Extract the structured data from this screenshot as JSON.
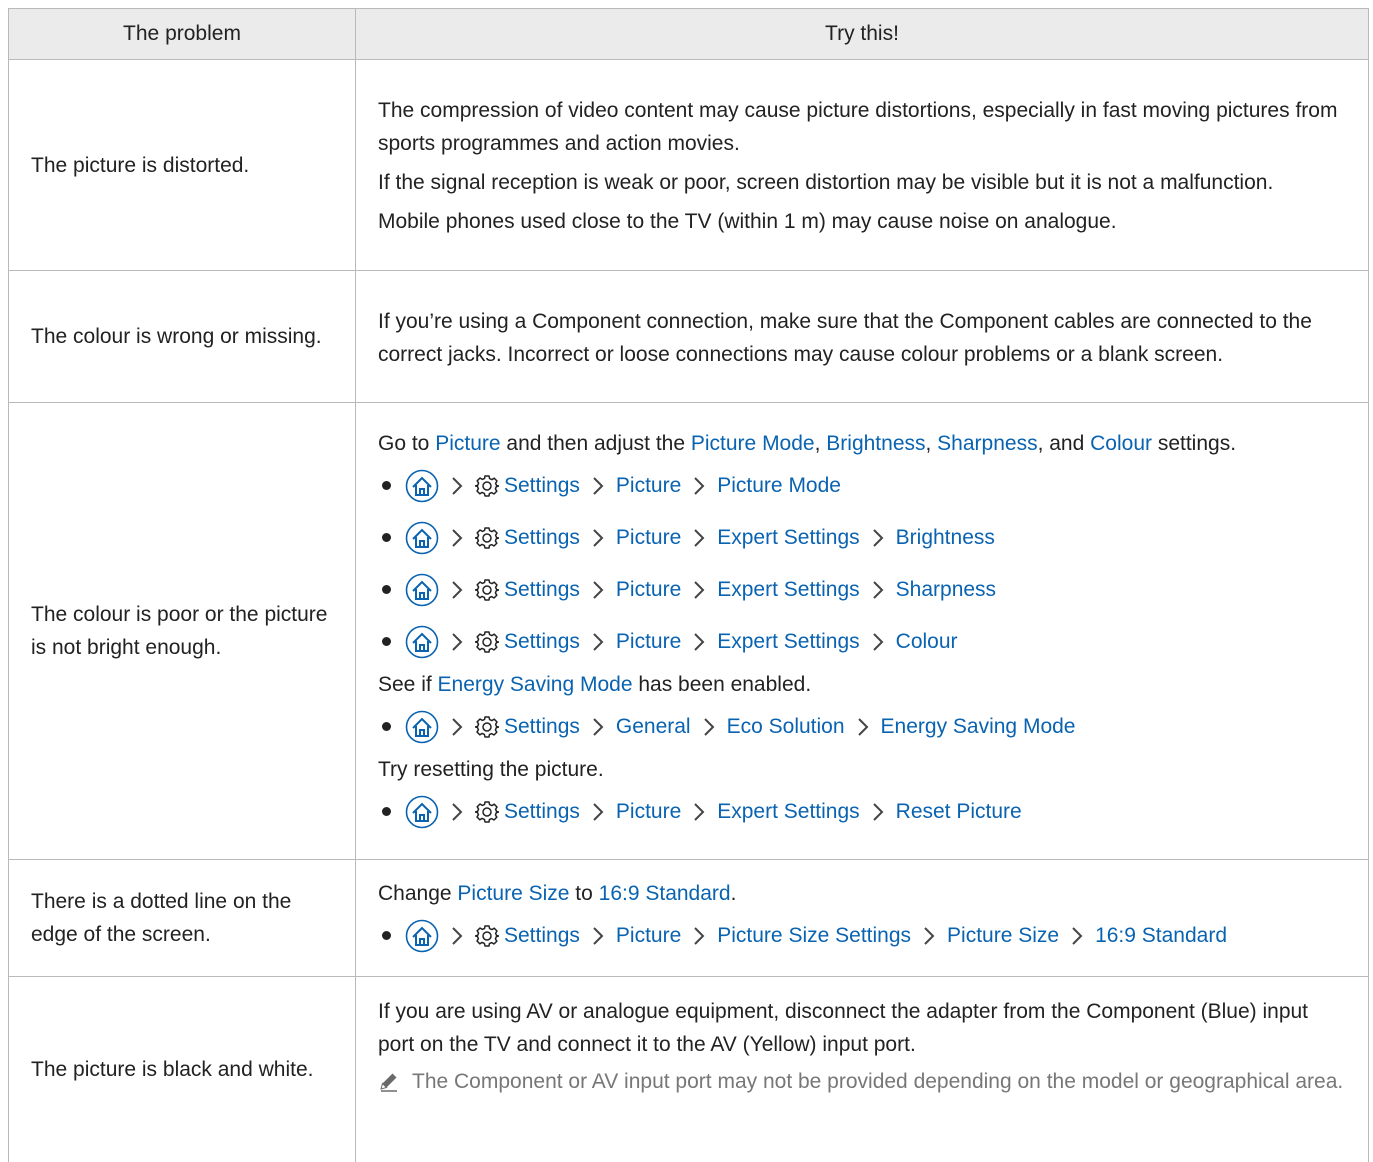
{
  "header": {
    "col1": "The problem",
    "col2": "Try this!"
  },
  "rows": [
    {
      "problem": "The picture is distorted.",
      "p1": "The compression of video content may cause picture distortions, especially in fast moving pictures from sports programmes and action movies.",
      "p2": "If the signal reception is weak or poor, screen distortion may be visible but it is not a malfunction.",
      "p3": "Mobile phones used close to the TV (within 1 m) may cause noise on analogue."
    },
    {
      "problem": "The colour is wrong or missing.",
      "p1": "If you’re using a Component connection, make sure that the Component cables are connected to the correct jacks. Incorrect or loose connections may cause colour problems or a blank screen."
    },
    {
      "problem": "The colour is poor or the picture is not bright enough.",
      "intro": {
        "a": "Go to ",
        "picture": "Picture",
        "b": " and then adjust the ",
        "mode": "Picture Mode",
        "c": ", ",
        "brightness": "Brightness",
        "d": ", ",
        "sharpness": "Sharpness",
        "e": ", and ",
        "colour": "Colour",
        "f": " settings."
      },
      "paths1": [
        [
          "Settings",
          "Picture",
          "Picture Mode"
        ],
        [
          "Settings",
          "Picture",
          "Expert Settings",
          "Brightness"
        ],
        [
          "Settings",
          "Picture",
          "Expert Settings",
          "Sharpness"
        ],
        [
          "Settings",
          "Picture",
          "Expert Settings",
          "Colour"
        ]
      ],
      "energy": {
        "a": "See if ",
        "link": "Energy Saving Mode",
        "b": " has been enabled."
      },
      "path2": [
        "Settings",
        "General",
        "Eco Solution",
        "Energy Saving Mode"
      ],
      "reset_text": "Try resetting the picture.",
      "path3": [
        "Settings",
        "Picture",
        "Expert Settings",
        "Reset Picture"
      ]
    },
    {
      "problem": "There is a dotted line on the edge of the screen.",
      "change": {
        "a": "Change ",
        "size": "Picture Size",
        "b": " to ",
        "std": "16:9 Standard",
        "c": "."
      },
      "path": [
        "Settings",
        "Picture",
        "Picture Size Settings",
        "Picture Size",
        "16:9 Standard"
      ]
    },
    {
      "problem": "The picture is black and white.",
      "p1": "If you are using AV or analogue equipment, disconnect the adapter from the Component (Blue) input port on the TV and connect it to the AV (Yellow) input port.",
      "note": "The Component or AV input port may not be provided depending on the model or geographical area."
    }
  ],
  "colors": {
    "link": "#0a63b1",
    "border": "#b9b9b9",
    "header_bg": "#ebebeb",
    "note": "#777777"
  },
  "icons": [
    "home-icon",
    "gear-icon",
    "chevron-right-icon",
    "pencil-icon"
  ]
}
